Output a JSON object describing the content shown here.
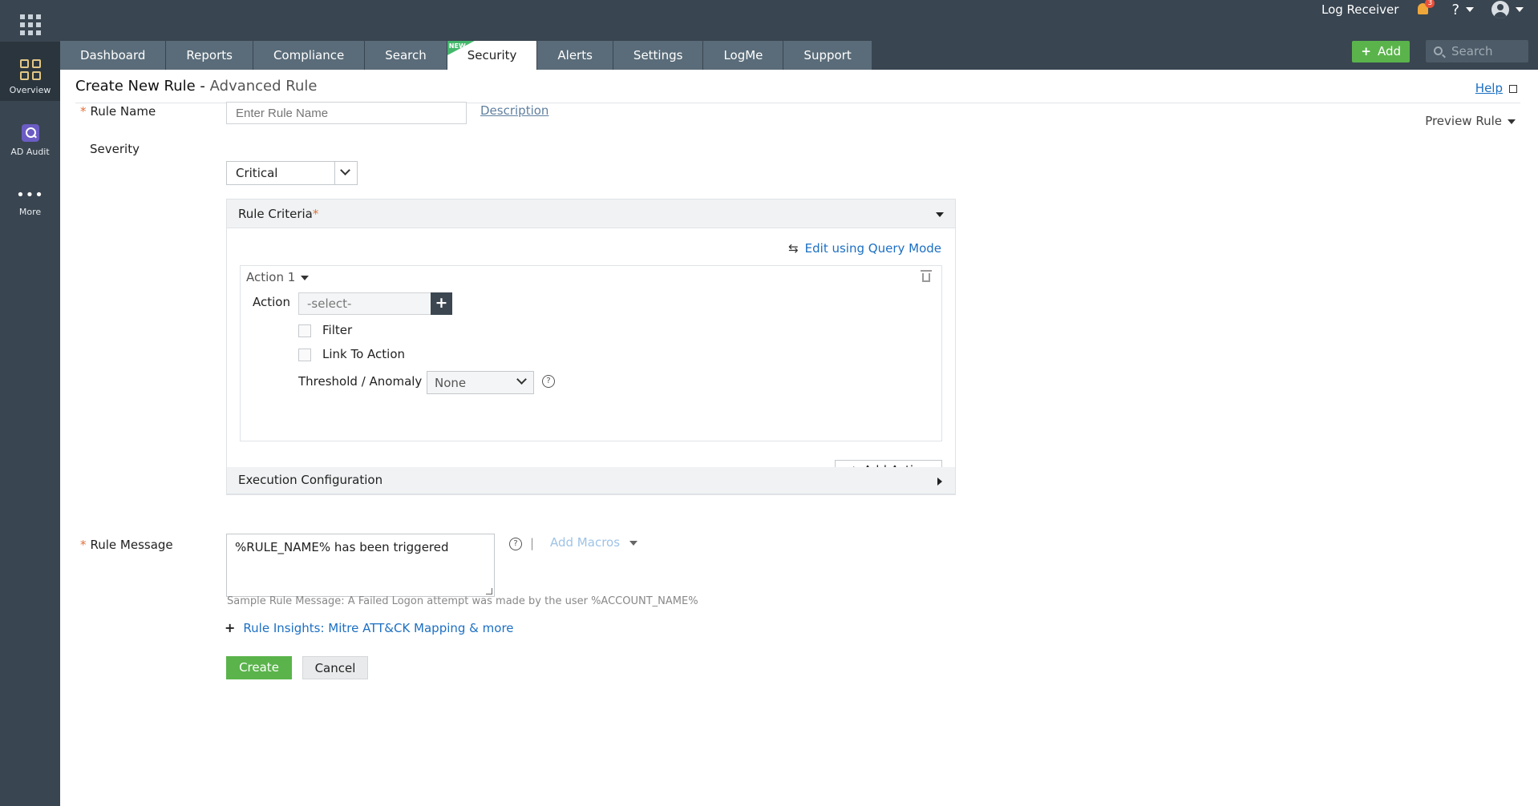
{
  "rail": {
    "overview": "Overview",
    "ad_audit": "AD Audit",
    "more": "More"
  },
  "topbar": {
    "log_receiver": "Log Receiver",
    "notification_count": "3",
    "help": "?",
    "tabs": [
      {
        "label": "Dashboard"
      },
      {
        "label": "Reports"
      },
      {
        "label": "Compliance"
      },
      {
        "label": "Search"
      },
      {
        "label": "Security",
        "badge": "NEW",
        "active": true
      },
      {
        "label": "Alerts"
      },
      {
        "label": "Settings"
      },
      {
        "label": "LogMe"
      },
      {
        "label": "Support"
      }
    ],
    "add_label": "Add",
    "search_placeholder": "Search"
  },
  "page": {
    "title": "Create New Rule - ",
    "subtitle": "Advanced Rule",
    "help_label": "Help",
    "preview_rule": "Preview Rule"
  },
  "form": {
    "rule_name_label": "Rule Name",
    "rule_name_placeholder": "Enter Rule Name",
    "description_link": "Description",
    "severity_label": "Severity",
    "severity_value": "Critical",
    "criteria": {
      "title": "Rule Criteria",
      "required_mark": "*",
      "query_mode": "Edit using Query Mode",
      "action_title": "Action 1",
      "action_label": "Action",
      "action_select": "-select-",
      "filter_label": "Filter",
      "link_action_label": "Link To Action",
      "threshold_label": "Threshold / Anomaly model",
      "threshold_value": "None",
      "add_action": "Add Action"
    },
    "execution_config": "Execution Configuration",
    "rule_message_label": "Rule Message",
    "rule_message_value": "%RULE_NAME% has been triggered",
    "add_macros": "Add Macros",
    "separator": "|",
    "sample_message": "Sample Rule Message: A Failed Logon attempt was made by the user %ACCOUNT_NAME%",
    "insights_link": "Rule Insights: Mitre ATT&CK Mapping & more",
    "create_label": "Create",
    "cancel_label": "Cancel"
  },
  "colors": {
    "topbar": "#394550",
    "tab": "#5a6c79",
    "accent_green": "#5ab44b",
    "link_blue": "#1c6fc3"
  }
}
